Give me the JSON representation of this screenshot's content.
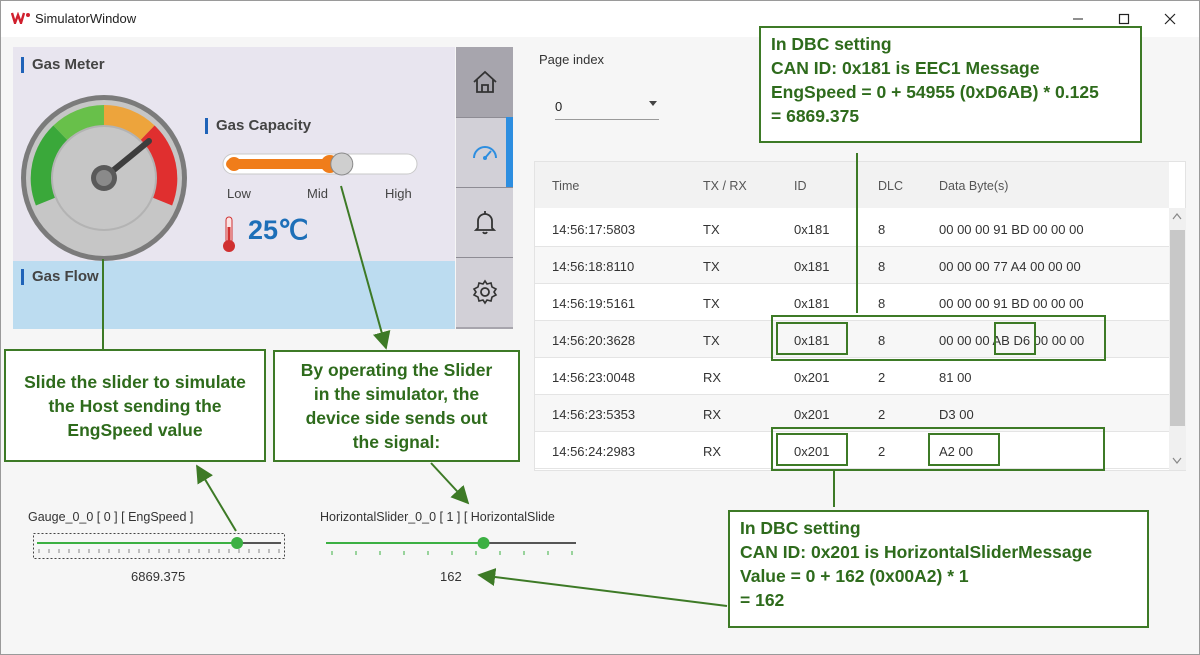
{
  "window": {
    "title": "SimulatorWindow",
    "minimize_icon": "minimize-icon",
    "maximize_icon": "maximize-icon",
    "close_icon": "close-icon"
  },
  "hmi": {
    "gas_meter_title": "Gas Meter",
    "gas_capacity_title": "Gas Capacity",
    "gas_flow_title": "Gas Flow",
    "capacity_labels": {
      "low": "Low",
      "mid": "Mid",
      "high": "High"
    },
    "temperature": "25℃",
    "nav": [
      "home-icon",
      "gauge-icon",
      "bell-icon",
      "gear-icon"
    ],
    "colors": {
      "accent": "#1f63b8",
      "active": "#2d8ee0",
      "slider_fill": "#f07d1a",
      "temp": "#1d6fb8"
    }
  },
  "page_index": {
    "label": "Page index",
    "value": "0"
  },
  "can_table": {
    "headers": {
      "time": "Time",
      "txrx": "TX / RX",
      "id": "ID",
      "dlc": "DLC",
      "data": "Data Byte(s)"
    },
    "rows": [
      {
        "time": "14:56:17:5803",
        "txrx": "TX",
        "id": "0x181",
        "dlc": "8",
        "data": "00 00 00 91 BD 00 00 00"
      },
      {
        "time": "14:56:18:8110",
        "txrx": "TX",
        "id": "0x181",
        "dlc": "8",
        "data": "00 00 00 77 A4 00 00 00"
      },
      {
        "time": "14:56:19:5161",
        "txrx": "TX",
        "id": "0x181",
        "dlc": "8",
        "data": "00 00 00 91 BD 00 00 00"
      },
      {
        "time": "14:56:20:3628",
        "txrx": "TX",
        "id": "0x181",
        "dlc": "8",
        "data": "00 00 00 AB D6 00 00 00"
      },
      {
        "time": "14:56:23:0048",
        "txrx": "RX",
        "id": "0x201",
        "dlc": "2",
        "data": "81 00"
      },
      {
        "time": "14:56:23:5353",
        "txrx": "RX",
        "id": "0x201",
        "dlc": "2",
        "data": "D3 00"
      },
      {
        "time": "14:56:24:2983",
        "txrx": "RX",
        "id": "0x201",
        "dlc": "2",
        "data": "A2 00"
      }
    ]
  },
  "gauge_widget": {
    "label": "Gauge_0_0  [  0  ]  [  EngSpeed  ]",
    "value": "6869.375",
    "level": 0.82
  },
  "slider_widget": {
    "label": "HorizontalSlider_0_0  [  1  ]  [  HorizontalSlide",
    "value": "162",
    "level": 0.63
  },
  "capacity_level": 0.6,
  "callouts": {
    "host": [
      "Slide the slider to simulate",
      "the Host sending the",
      "EngSpeed value"
    ],
    "device": [
      "By operating the Slider",
      "in the simulator, the",
      "device side sends out",
      "the signal:"
    ],
    "eec1": [
      "In DBC setting",
      "CAN ID: 0x181 is EEC1 Message",
      "EngSpeed = 0 + 54955 (0xD6AB) * 0.125",
      "= 6869.375"
    ],
    "hsm": [
      "In DBC setting",
      "CAN ID: 0x201 is HorizontalSliderMessage",
      "Value = 0 + 162 (0x00A2) * 1",
      "= 162"
    ],
    "color": "#3d7a26"
  }
}
